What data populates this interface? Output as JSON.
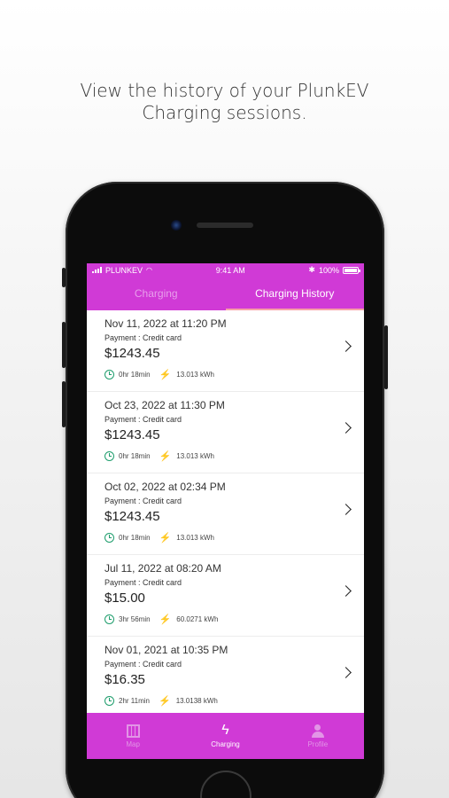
{
  "headline": {
    "line1": "View the history of your PlunkEV",
    "line2": "Charging sessions."
  },
  "status_bar": {
    "carrier": "PLUNKEV",
    "time": "9:41 AM",
    "battery": "100%"
  },
  "tabs": [
    {
      "label": "Charging",
      "active": false
    },
    {
      "label": "Charging History",
      "active": true
    }
  ],
  "sessions": [
    {
      "date": "Nov 11, 2022 at 11:20 PM",
      "payment": "Payment : Credit card",
      "amount": "$1243.45",
      "duration": "0hr 18min",
      "energy": "13.013 kWh"
    },
    {
      "date": "Oct 23, 2022 at 11:30 PM",
      "payment": "Payment : Credit card",
      "amount": "$1243.45",
      "duration": "0hr 18min",
      "energy": "13.013 kWh"
    },
    {
      "date": "Oct 02, 2022 at 02:34 PM",
      "payment": "Payment : Credit card",
      "amount": "$1243.45",
      "duration": "0hr 18min",
      "energy": "13.013 kWh"
    },
    {
      "date": "Jul 11, 2022 at 08:20 AM",
      "payment": "Payment : Credit card",
      "amount": "$15.00",
      "duration": "3hr 56min",
      "energy": "60.0271 kWh"
    },
    {
      "date": "Nov 01, 2021 at 10:35 PM",
      "payment": "Payment : Credit card",
      "amount": "$16.35",
      "duration": "2hr 11min",
      "energy": "13.0138 kWh"
    }
  ],
  "bottom_nav": [
    {
      "label": "Map",
      "icon": "map-icon",
      "active": false
    },
    {
      "label": "Charging",
      "icon": "bolt-icon",
      "active": true
    },
    {
      "label": "Profile",
      "icon": "person-icon",
      "active": false
    }
  ],
  "colors": {
    "brand": "#d03ad6",
    "accent_green": "#1e9d6c",
    "tab_indicator": "#f7a1a8"
  }
}
